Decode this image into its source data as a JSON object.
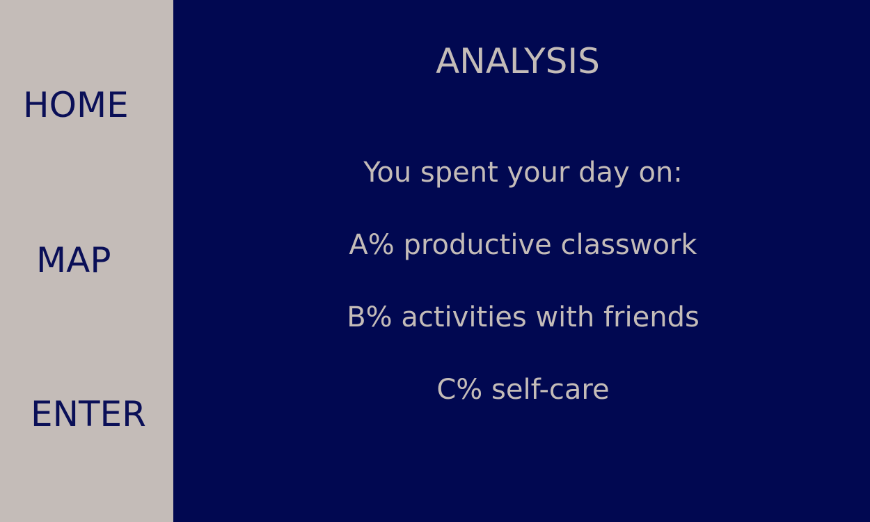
{
  "sidebar": {
    "items": [
      {
        "label": "HOME"
      },
      {
        "label": "MAP"
      },
      {
        "label": "ENTER"
      }
    ]
  },
  "main": {
    "title": "ANALYSIS",
    "lines": [
      "You spent your day on:",
      "A% productive classwork",
      "B% activities with friends",
      "C% self-care"
    ]
  },
  "colors": {
    "background": "#010851",
    "sidebar": "#c4bcb8",
    "nav_text": "#0a0f57",
    "main_text": "#c4bcb8"
  }
}
